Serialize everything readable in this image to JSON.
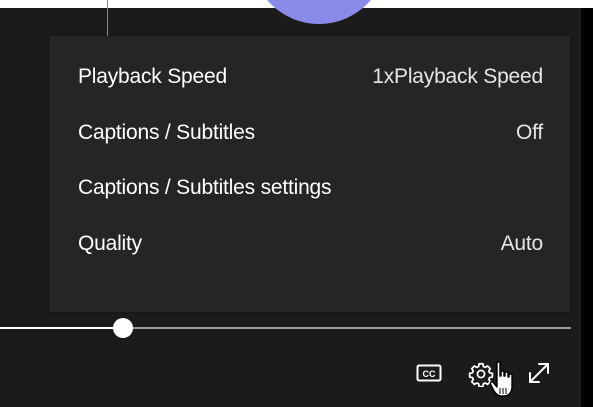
{
  "settings_menu": {
    "items": [
      {
        "label": "Playback Speed",
        "value": "1xPlayback Speed"
      },
      {
        "label": "Captions / Subtitles",
        "value": "Off"
      },
      {
        "label": "Captions / Subtitles settings",
        "value": ""
      },
      {
        "label": "Quality",
        "value": "Auto"
      }
    ]
  },
  "progress": {
    "played_fraction": 0.215
  },
  "controls": {
    "captions_icon": "closed-captions-icon",
    "settings_icon": "gear-icon",
    "fullscreen_icon": "fullscreen-icon"
  },
  "colors": {
    "player_background": "#1b1b1b",
    "menu_background": "#252525",
    "accent_circle": "#8a8ae8"
  }
}
